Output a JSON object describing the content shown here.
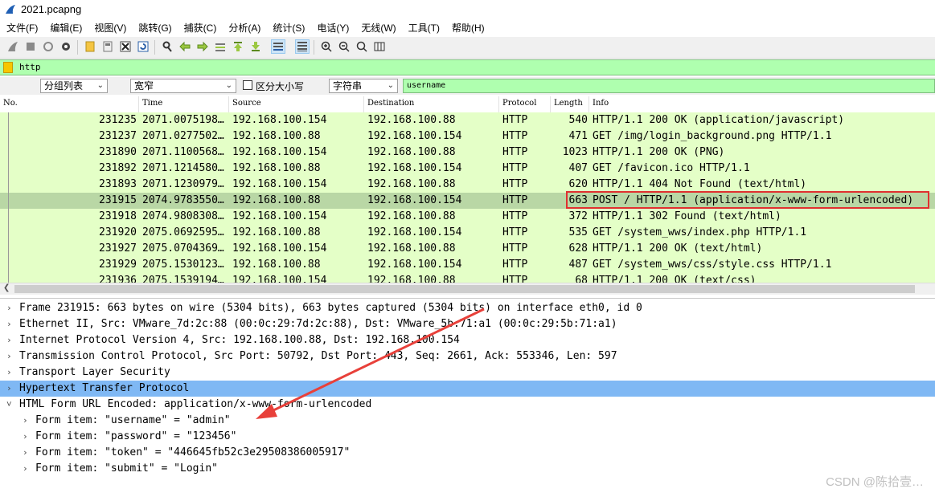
{
  "window": {
    "title": "2021.pcapng"
  },
  "menu": [
    "文件(F)",
    "编辑(E)",
    "视图(V)",
    "跳转(G)",
    "捕获(C)",
    "分析(A)",
    "统计(S)",
    "电话(Y)",
    "无线(W)",
    "工具(T)",
    "帮助(H)"
  ],
  "display_filter": {
    "value": "http"
  },
  "search": {
    "scope": "分组列表",
    "charset": "宽窄",
    "case_label": "区分大小写",
    "type": "字符串",
    "value": "username"
  },
  "packet_list": {
    "columns": [
      "No.",
      "Time",
      "Source",
      "Destination",
      "Protocol",
      "Length",
      "Info"
    ],
    "rows": [
      {
        "no": "231235",
        "time": "2071.0075198…",
        "src": "192.168.100.154",
        "dst": "192.168.100.88",
        "proto": "HTTP",
        "len": "540",
        "info": "HTTP/1.1 200 OK  (application/javascript)"
      },
      {
        "no": "231237",
        "time": "2071.0277502…",
        "src": "192.168.100.88",
        "dst": "192.168.100.154",
        "proto": "HTTP",
        "len": "471",
        "info": "GET /img/login_background.png HTTP/1.1"
      },
      {
        "no": "231890",
        "time": "2071.1100568…",
        "src": "192.168.100.154",
        "dst": "192.168.100.88",
        "proto": "HTTP",
        "len": "1023",
        "info": "HTTP/1.1 200 OK  (PNG)"
      },
      {
        "no": "231892",
        "time": "2071.1214580…",
        "src": "192.168.100.88",
        "dst": "192.168.100.154",
        "proto": "HTTP",
        "len": "407",
        "info": "GET /favicon.ico HTTP/1.1"
      },
      {
        "no": "231893",
        "time": "2071.1230979…",
        "src": "192.168.100.154",
        "dst": "192.168.100.88",
        "proto": "HTTP",
        "len": "620",
        "info": "HTTP/1.1 404 Not Found  (text/html)"
      },
      {
        "no": "231915",
        "time": "2074.9783550…",
        "src": "192.168.100.88",
        "dst": "192.168.100.154",
        "proto": "HTTP",
        "len": "663",
        "info": "POST / HTTP/1.1  (application/x-www-form-urlencoded)"
      },
      {
        "no": "231918",
        "time": "2074.9808308…",
        "src": "192.168.100.154",
        "dst": "192.168.100.88",
        "proto": "HTTP",
        "len": "372",
        "info": "HTTP/1.1 302 Found  (text/html)"
      },
      {
        "no": "231920",
        "time": "2075.0692595…",
        "src": "192.168.100.88",
        "dst": "192.168.100.154",
        "proto": "HTTP",
        "len": "535",
        "info": "GET /system_wws/index.php HTTP/1.1"
      },
      {
        "no": "231927",
        "time": "2075.0704369…",
        "src": "192.168.100.154",
        "dst": "192.168.100.88",
        "proto": "HTTP",
        "len": "628",
        "info": "HTTP/1.1 200 OK  (text/html)"
      },
      {
        "no": "231929",
        "time": "2075.1530123…",
        "src": "192.168.100.88",
        "dst": "192.168.100.154",
        "proto": "HTTP",
        "len": "487",
        "info": "GET /system_wws/css/style.css HTTP/1.1"
      },
      {
        "no": "231936",
        "time": "2075.1539194…",
        "src": "192.168.100.154",
        "dst": "192.168.100.88",
        "proto": "HTTP",
        "len": "68",
        "info": "HTTP/1.1 200 OK  (text/css)"
      }
    ]
  },
  "details": {
    "rows": [
      {
        "text": "Frame 231915: 663 bytes on wire (5304 bits), 663 bytes captured (5304 bits) on interface eth0, id 0"
      },
      {
        "text": "Ethernet II, Src: VMware_7d:2c:88 (00:0c:29:7d:2c:88), Dst: VMware_5b:71:a1 (00:0c:29:5b:71:a1)"
      },
      {
        "text": "Internet Protocol Version 4, Src: 192.168.100.88, Dst: 192.168.100.154"
      },
      {
        "text": "Transmission Control Protocol, Src Port: 50792, Dst Port: 443, Seq: 2661, Ack: 553346, Len: 597"
      },
      {
        "text": "Transport Layer Security"
      },
      {
        "text": "Hypertext Transfer Protocol"
      },
      {
        "text": "HTML Form URL Encoded: application/x-www-form-urlencoded"
      },
      {
        "text": "Form item: \"username\" = \"admin\""
      },
      {
        "text": "Form item: \"password\" = \"123456\""
      },
      {
        "text": "Form item: \"token\" = \"446645fb52c3e29508386005917\""
      },
      {
        "text": "Form item: \"submit\" = \"Login\""
      }
    ]
  },
  "watermark": "CSDN @陈拾壹…",
  "colors": {
    "row_bg": "#e4ffc7",
    "row_selected": "#b9d7a5",
    "filter_bg": "#afffaf",
    "detail_highlight": "#7fb8f4",
    "annotation": "#e03030"
  }
}
